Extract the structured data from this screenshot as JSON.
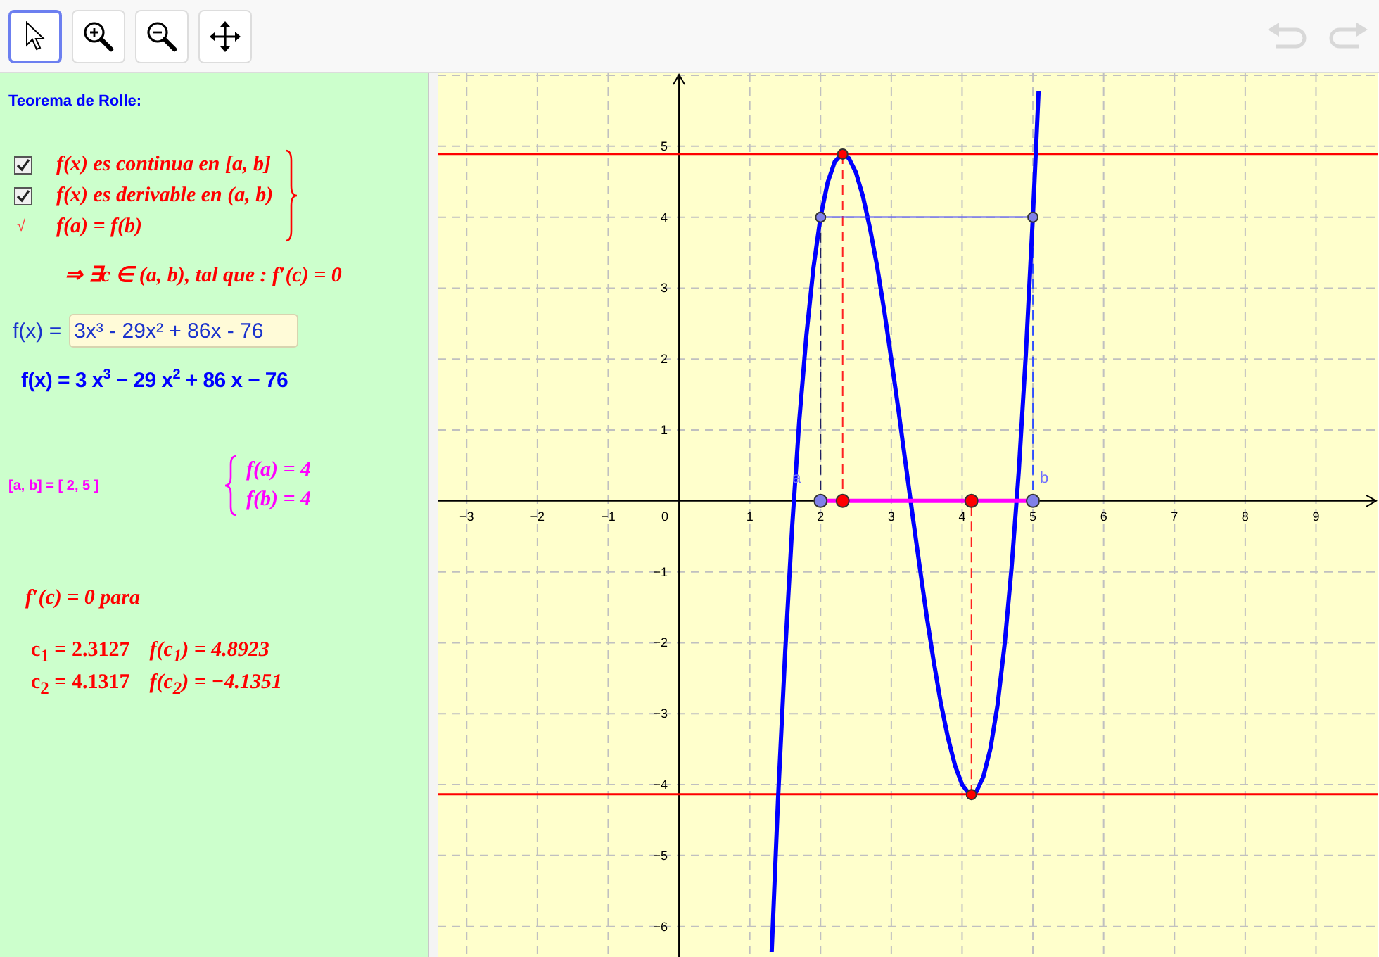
{
  "toolbar": {
    "tools": [
      {
        "kind": "pointer",
        "selected": true
      },
      {
        "kind": "zoom-in",
        "selected": false
      },
      {
        "kind": "zoom-out",
        "selected": false
      },
      {
        "kind": "move",
        "selected": false
      }
    ],
    "history": [
      {
        "kind": "undo",
        "disabled": true
      },
      {
        "kind": "redo",
        "disabled": true
      }
    ]
  },
  "algebra_panel": {
    "title": "Teorema de Rolle:",
    "conditions": [
      {
        "kind": "checkbox",
        "checked": true,
        "text": "f(x) es continua en [a, b]"
      },
      {
        "kind": "checkbox",
        "checked": true,
        "text": "f(x) es derivable en (a, b)"
      },
      {
        "kind": "mark",
        "symbol": "√",
        "text": "f(a) = f(b)"
      }
    ],
    "conclusion": "⇒ ∃c ∈ (a, b), tal que : f′(c) = 0",
    "input": {
      "label": "f(x) =",
      "value": "3x³ - 29x² + 86x - 76"
    },
    "function": "f(x) = 3 x$^{3}$ − 29 x$^{2}$ + 86 x − 76",
    "interval": "[a, b] = [ 2, 5 ]",
    "endpoint_values": [
      "f(a) = 4",
      "f(b) = 4"
    ],
    "critical_heading": "f′(c) = 0  para",
    "critical_points": [
      {
        "c": "c$_{1}$ = 2.3127",
        "value": "f(c$_{1}$) = 4.8923"
      },
      {
        "c": "c$_{2}$ = 4.1317",
        "value": "f(c$_{2}$) = −4.1351"
      }
    ]
  },
  "graphics": {
    "origin_label": "0",
    "chart_data": {
      "type": "line",
      "grid": true,
      "xlim": [
        -3.41,
        9.87
      ],
      "ylim": [
        -6.43,
        6.03
      ],
      "xticks": [
        {
          "value": -3,
          "label": "−3"
        },
        {
          "value": -2,
          "label": "−2"
        },
        {
          "value": -1,
          "label": "−1"
        },
        1,
        2,
        3,
        4,
        5,
        6,
        7,
        8,
        9
      ],
      "yticks": [
        {
          "value": -6,
          "label": "−6"
        },
        {
          "value": -5,
          "label": "−5"
        },
        {
          "value": -4,
          "label": "−4"
        },
        {
          "value": -3,
          "label": "−3"
        },
        {
          "value": -2,
          "label": "−2"
        },
        {
          "value": -1,
          "label": "−1"
        },
        1,
        2,
        3,
        4,
        5
      ],
      "x": [
        1.31,
        1.4,
        1.5,
        1.6,
        1.7,
        1.8,
        1.9,
        2.0,
        2.1,
        2.2,
        2.3,
        2.3127,
        2.4,
        2.5,
        2.6,
        2.7,
        2.8,
        2.9,
        3.0,
        3.1,
        3.2,
        3.3,
        3.4,
        3.5,
        3.6,
        3.7,
        3.8,
        3.9,
        4.0,
        4.1,
        4.1317,
        4.2,
        4.3,
        4.4,
        4.5,
        4.6,
        4.7,
        4.8,
        4.9,
        5.0,
        5.08
      ],
      "series": [
        {
          "type": "line",
          "color": "#0000ff",
          "values": [
            -6.36,
            -4.21,
            -2.13,
            -0.35,
            1.13,
            2.34,
            3.29,
            4,
            4.49,
            4.78,
            4.89,
            4.89,
            4.83,
            4.63,
            4.29,
            3.84,
            3.3,
            2.68,
            2,
            1.28,
            0.54,
            -0.2,
            -0.93,
            -1.63,
            -2.27,
            -2.85,
            -3.34,
            -3.73,
            -4,
            -4.13,
            -4.14,
            -4.1,
            -3.89,
            -3.49,
            -2.88,
            -2.03,
            -0.94,
            0.42,
            2.06,
            4,
            5.78
          ]
        },
        {
          "type": "line",
          "color": "#ff00ff",
          "values": [
            null,
            null,
            null,
            null,
            null,
            null,
            null,
            0,
            0,
            0,
            0,
            0,
            0,
            0,
            0,
            0,
            0,
            0,
            0,
            0,
            0,
            0,
            0,
            0,
            0,
            0,
            0,
            0,
            0,
            0,
            0,
            0,
            0,
            0,
            0,
            0,
            0,
            0,
            0,
            0,
            null
          ]
        },
        {
          "type": "line",
          "color": "#4040ff",
          "values": [
            null,
            null,
            null,
            null,
            null,
            null,
            null,
            4,
            4,
            4,
            4,
            4,
            4,
            4,
            4,
            4,
            4,
            4,
            4,
            4,
            4,
            4,
            4,
            4,
            4,
            4,
            4,
            4,
            4,
            4,
            4,
            4,
            4,
            4,
            4,
            4,
            4,
            4,
            4,
            4,
            null
          ]
        },
        {
          "type": "scatter",
          "color": "#ff0000",
          "values": [
            null,
            null,
            null,
            null,
            null,
            null,
            null,
            null,
            null,
            null,
            null,
            4.89,
            null,
            null,
            null,
            null,
            null,
            null,
            null,
            null,
            null,
            null,
            null,
            null,
            null,
            null,
            null,
            null,
            null,
            null,
            -4.14,
            null,
            null,
            null,
            null,
            null,
            null,
            null,
            null,
            null,
            null
          ]
        },
        {
          "type": "scatter",
          "color": "#8080e8",
          "values": [
            null,
            null,
            null,
            null,
            null,
            null,
            null,
            4,
            null,
            null,
            null,
            null,
            null,
            null,
            null,
            null,
            null,
            null,
            null,
            null,
            null,
            null,
            null,
            null,
            null,
            null,
            null,
            null,
            null,
            null,
            null,
            null,
            null,
            null,
            null,
            null,
            null,
            null,
            null,
            4,
            null
          ]
        }
      ],
      "ref_lines": [
        {
          "axis": "y",
          "value": 4.8923,
          "color": "#ff0000"
        },
        {
          "axis": "y",
          "value": -4.1351,
          "color": "#ff0000"
        },
        {
          "axis": "x",
          "value": 2,
          "color": "#202060"
        },
        {
          "axis": "x",
          "value": 5,
          "color": "#3050ff"
        },
        {
          "axis": "x",
          "value": 2.3127,
          "color": "#ff2020"
        },
        {
          "axis": "x",
          "value": 4.1317,
          "color": "#ff2020"
        }
      ],
      "annotations": [
        {
          "text": "a",
          "x": 2,
          "y": 0
        },
        {
          "text": "b",
          "x": 5,
          "y": 0
        }
      ]
    }
  }
}
